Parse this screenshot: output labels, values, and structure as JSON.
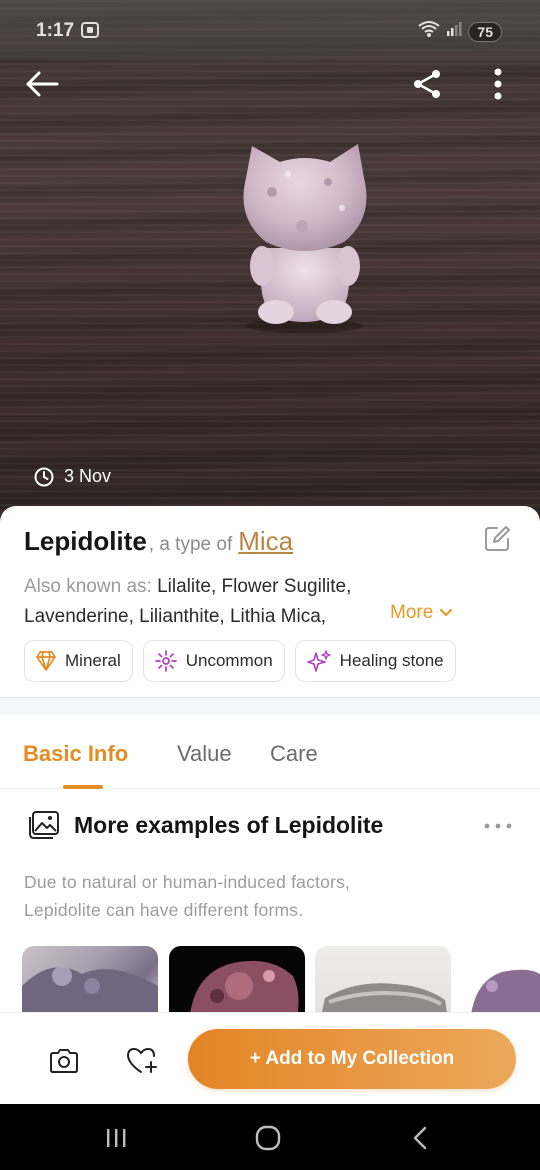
{
  "status_bar": {
    "time": "1:17",
    "battery": "75",
    "icons": [
      "screen-record-icon",
      "wifi-icon",
      "signal-icon",
      "battery-icon"
    ]
  },
  "hero": {
    "date": "3 Nov",
    "icons": [
      "back-arrow-icon",
      "share-icon",
      "more-vertical-icon",
      "clock-icon"
    ]
  },
  "identity": {
    "name": "Lepidolite",
    "type_prefix": ", a type of",
    "type_link": "Mica",
    "aka_label": "Also known as:",
    "aka_line1": " Lilalite, Flower Sugilite,",
    "aka_line2": "Lavenderine, Lilianthite, Lithia Mica,",
    "more": "More"
  },
  "tags": [
    {
      "label": "Mineral",
      "icon": "crystal-icon"
    },
    {
      "label": "Uncommon",
      "icon": "sparkle-burst-icon"
    },
    {
      "label": "Healing stone",
      "icon": "sparkles-icon"
    }
  ],
  "tabs": [
    {
      "label": "Basic Info",
      "active": true
    },
    {
      "label": "Value",
      "active": false
    },
    {
      "label": "Care",
      "active": false
    }
  ],
  "examples": {
    "title": "More examples of Lepidolite",
    "description_line1": "Due to natural or human-induced factors,",
    "description_line2": "Lepidolite can have different forms."
  },
  "actions": {
    "add_label": "+ Add to My Collection",
    "icons": [
      "camera-icon",
      "heart-plus-icon"
    ]
  },
  "colors": {
    "accent": "#e48c22",
    "link": "#b98545",
    "more": "#e79a25"
  }
}
